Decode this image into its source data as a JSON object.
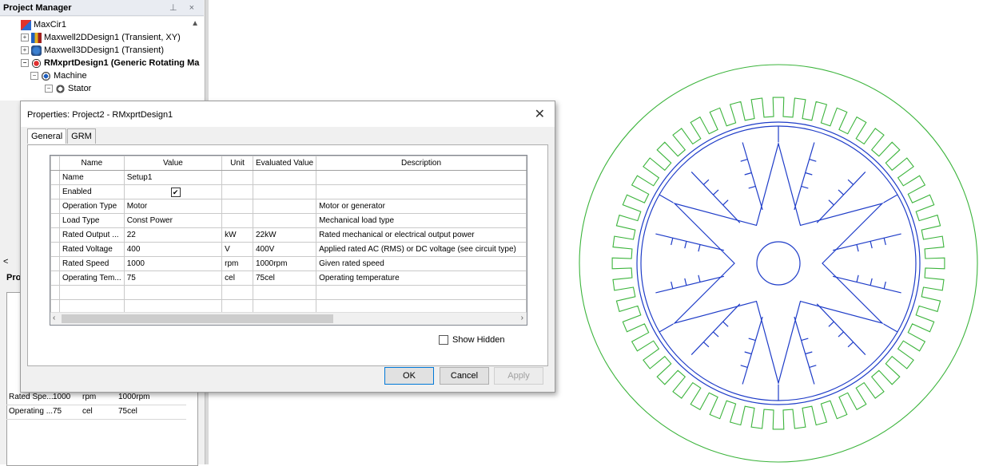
{
  "project_manager": {
    "title": "Project Manager",
    "header_icons": "⊥ ×",
    "tree": [
      {
        "label": "MaxCir1",
        "bold": false,
        "expander": ""
      },
      {
        "label": "Maxwell2DDesign1 (Transient, XY)",
        "bold": false,
        "expander": "+"
      },
      {
        "label": "Maxwell3DDesign1 (Transient)",
        "bold": false,
        "expander": "+"
      },
      {
        "label": "RMxprtDesign1 (Generic Rotating Ma",
        "bold": true,
        "expander": "−"
      },
      {
        "label": "Machine",
        "bold": false,
        "expander": "−"
      },
      {
        "label": "Stator",
        "bold": false,
        "expander": "−"
      }
    ]
  },
  "properties_panel": {
    "label": "Pro",
    "collapse": "<",
    "rows": [
      {
        "name": "Rated Spe...",
        "value": "1000",
        "unit": "rpm",
        "evaluated": "1000rpm"
      },
      {
        "name": "Operating ...",
        "value": "75",
        "unit": "cel",
        "evaluated": "75cel"
      }
    ]
  },
  "dialog": {
    "title": "Properties: Project2 - RMxprtDesign1",
    "close": "✕",
    "tabs": [
      "General",
      "GRM"
    ],
    "columns": [
      "Name",
      "Value",
      "Unit",
      "Evaluated Value",
      "Description"
    ],
    "rows": [
      {
        "name": "Name",
        "value": "Setup1",
        "unit": "",
        "evaluated": "",
        "description": ""
      },
      {
        "name": "Enabled",
        "value": "",
        "checkbox": "✔",
        "unit": "",
        "evaluated": "",
        "description": ""
      },
      {
        "name": "Operation Type",
        "value": "Motor",
        "unit": "",
        "evaluated": "",
        "description": "Motor or generator"
      },
      {
        "name": "Load Type",
        "value": "Const Power",
        "unit": "",
        "evaluated": "",
        "description": "Mechanical load type"
      },
      {
        "name": "Rated Output ...",
        "value": "22",
        "unit": "kW",
        "evaluated": "22kW",
        "description": "Rated mechanical or electrical output power"
      },
      {
        "name": "Rated Voltage",
        "value": "400",
        "unit": "V",
        "evaluated": "400V",
        "description": "Applied rated AC (RMS) or DC voltage (see circuit type)"
      },
      {
        "name": "Rated Speed",
        "value": "1000",
        "unit": "rpm",
        "evaluated": "1000rpm",
        "description": "Given rated speed"
      },
      {
        "name": "Operating Tem...",
        "value": "75",
        "unit": "cel",
        "evaluated": "75cel",
        "description": "Operating temperature"
      }
    ],
    "show_hidden": "Show Hidden",
    "buttons": {
      "ok": "OK",
      "cancel": "Cancel",
      "apply": "Apply"
    }
  },
  "colors": {
    "stator": "#3cb43c",
    "rotor": "#1e3cc8"
  }
}
